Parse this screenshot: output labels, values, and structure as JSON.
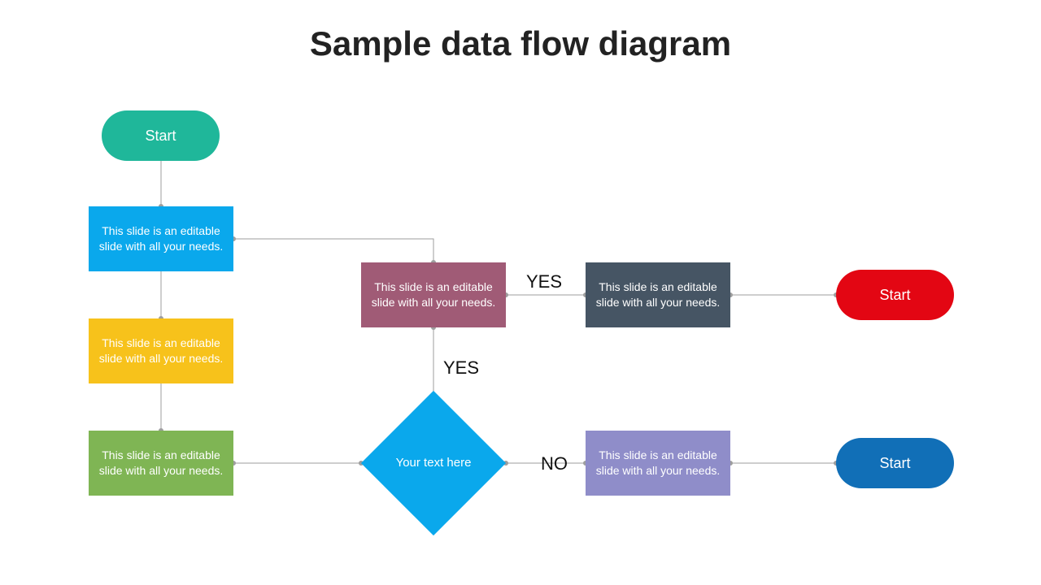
{
  "title": "Sample data flow diagram",
  "placeholder": "This slide is an editable slide with all your needs.",
  "diamond_text": "Your text here",
  "labels": {
    "yes": "YES",
    "no": "NO"
  },
  "terminals": {
    "start1": "Start",
    "right_top": "Start",
    "right_bottom": "Start"
  },
  "colors": {
    "start1": "#1fb79a",
    "box_blue": "#0aa8ec",
    "box_yellow": "#f7c21b",
    "box_green": "#7fb554",
    "box_purple": "#a05b76",
    "box_slate": "#465564",
    "box_violet": "#8f8dc9",
    "pill_red": "#e30613",
    "pill_blue": "#116fb7",
    "diamond": "#0aa8ec"
  }
}
